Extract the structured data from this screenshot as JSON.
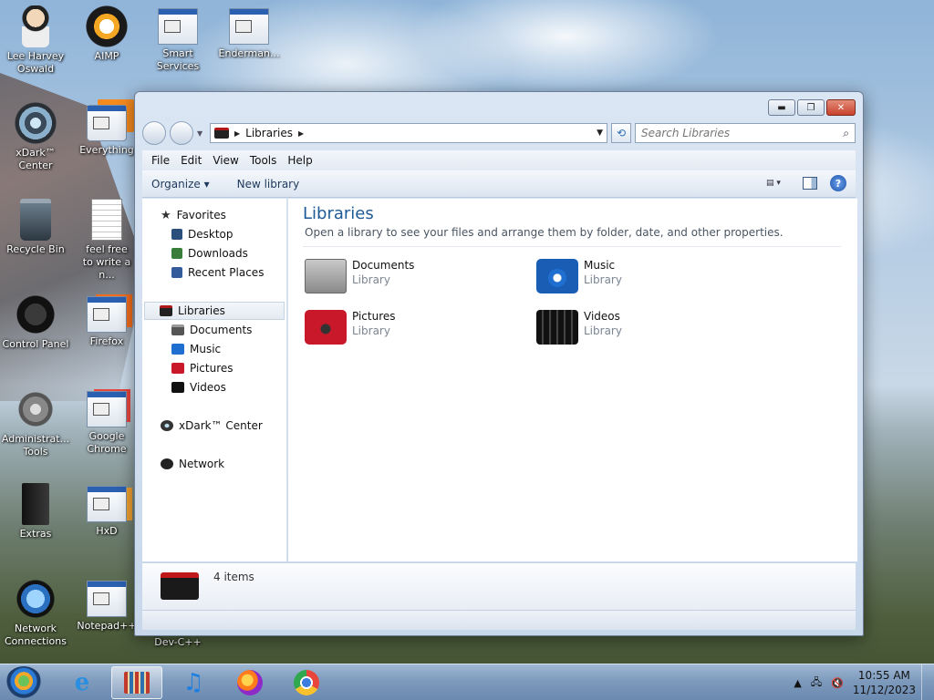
{
  "desktop": {
    "icons": [
      {
        "label": "Lee Harvey Oswald"
      },
      {
        "label": "AIMP"
      },
      {
        "label": "Smart Services"
      },
      {
        "label": "Enderman..."
      },
      {
        "label": "xDark™ Center"
      },
      {
        "label": "Everything"
      },
      {
        "label": "Recycle Bin"
      },
      {
        "label": "feel free to write a n..."
      },
      {
        "label": "Control Panel"
      },
      {
        "label": "Firefox"
      },
      {
        "label": "Administrat... Tools"
      },
      {
        "label": "Google Chrome"
      },
      {
        "label": "Extras"
      },
      {
        "label": "HxD"
      },
      {
        "label": "Network Connections"
      },
      {
        "label": "Notepad++"
      },
      {
        "label": "Dev-C++"
      }
    ]
  },
  "window": {
    "title": "Libraries",
    "buttons": {
      "minimize": "▬",
      "maximize": "❐",
      "close": "✕"
    },
    "address": {
      "crumb": "Libraries"
    },
    "search": {
      "placeholder": "Search Libraries"
    },
    "menu": [
      "File",
      "Edit",
      "View",
      "Tools",
      "Help"
    ],
    "toolbar": {
      "organize": "Organize ▾",
      "new_library": "New library",
      "help": "?"
    },
    "nav": {
      "favorites": "Favorites",
      "desktop": "Desktop",
      "downloads": "Downloads",
      "recent": "Recent Places",
      "libraries": "Libraries",
      "documents": "Documents",
      "music": "Music",
      "pictures": "Pictures",
      "videos": "Videos",
      "xdark": "xDark™ Center",
      "network": "Network"
    },
    "content": {
      "heading": "Libraries",
      "subtitle": "Open a library to see your files and arrange them by folder, date, and other properties.",
      "libraries": [
        {
          "name": "Documents",
          "type": "Library"
        },
        {
          "name": "Music",
          "type": "Library"
        },
        {
          "name": "Pictures",
          "type": "Library"
        },
        {
          "name": "Videos",
          "type": "Library"
        }
      ]
    },
    "details": {
      "count": "4 items"
    }
  },
  "taskbar": {
    "time": "10:55 AM",
    "date": "11/12/2023"
  },
  "colors": {
    "accent": "#1e5a96",
    "folder_red": "#c01818"
  }
}
